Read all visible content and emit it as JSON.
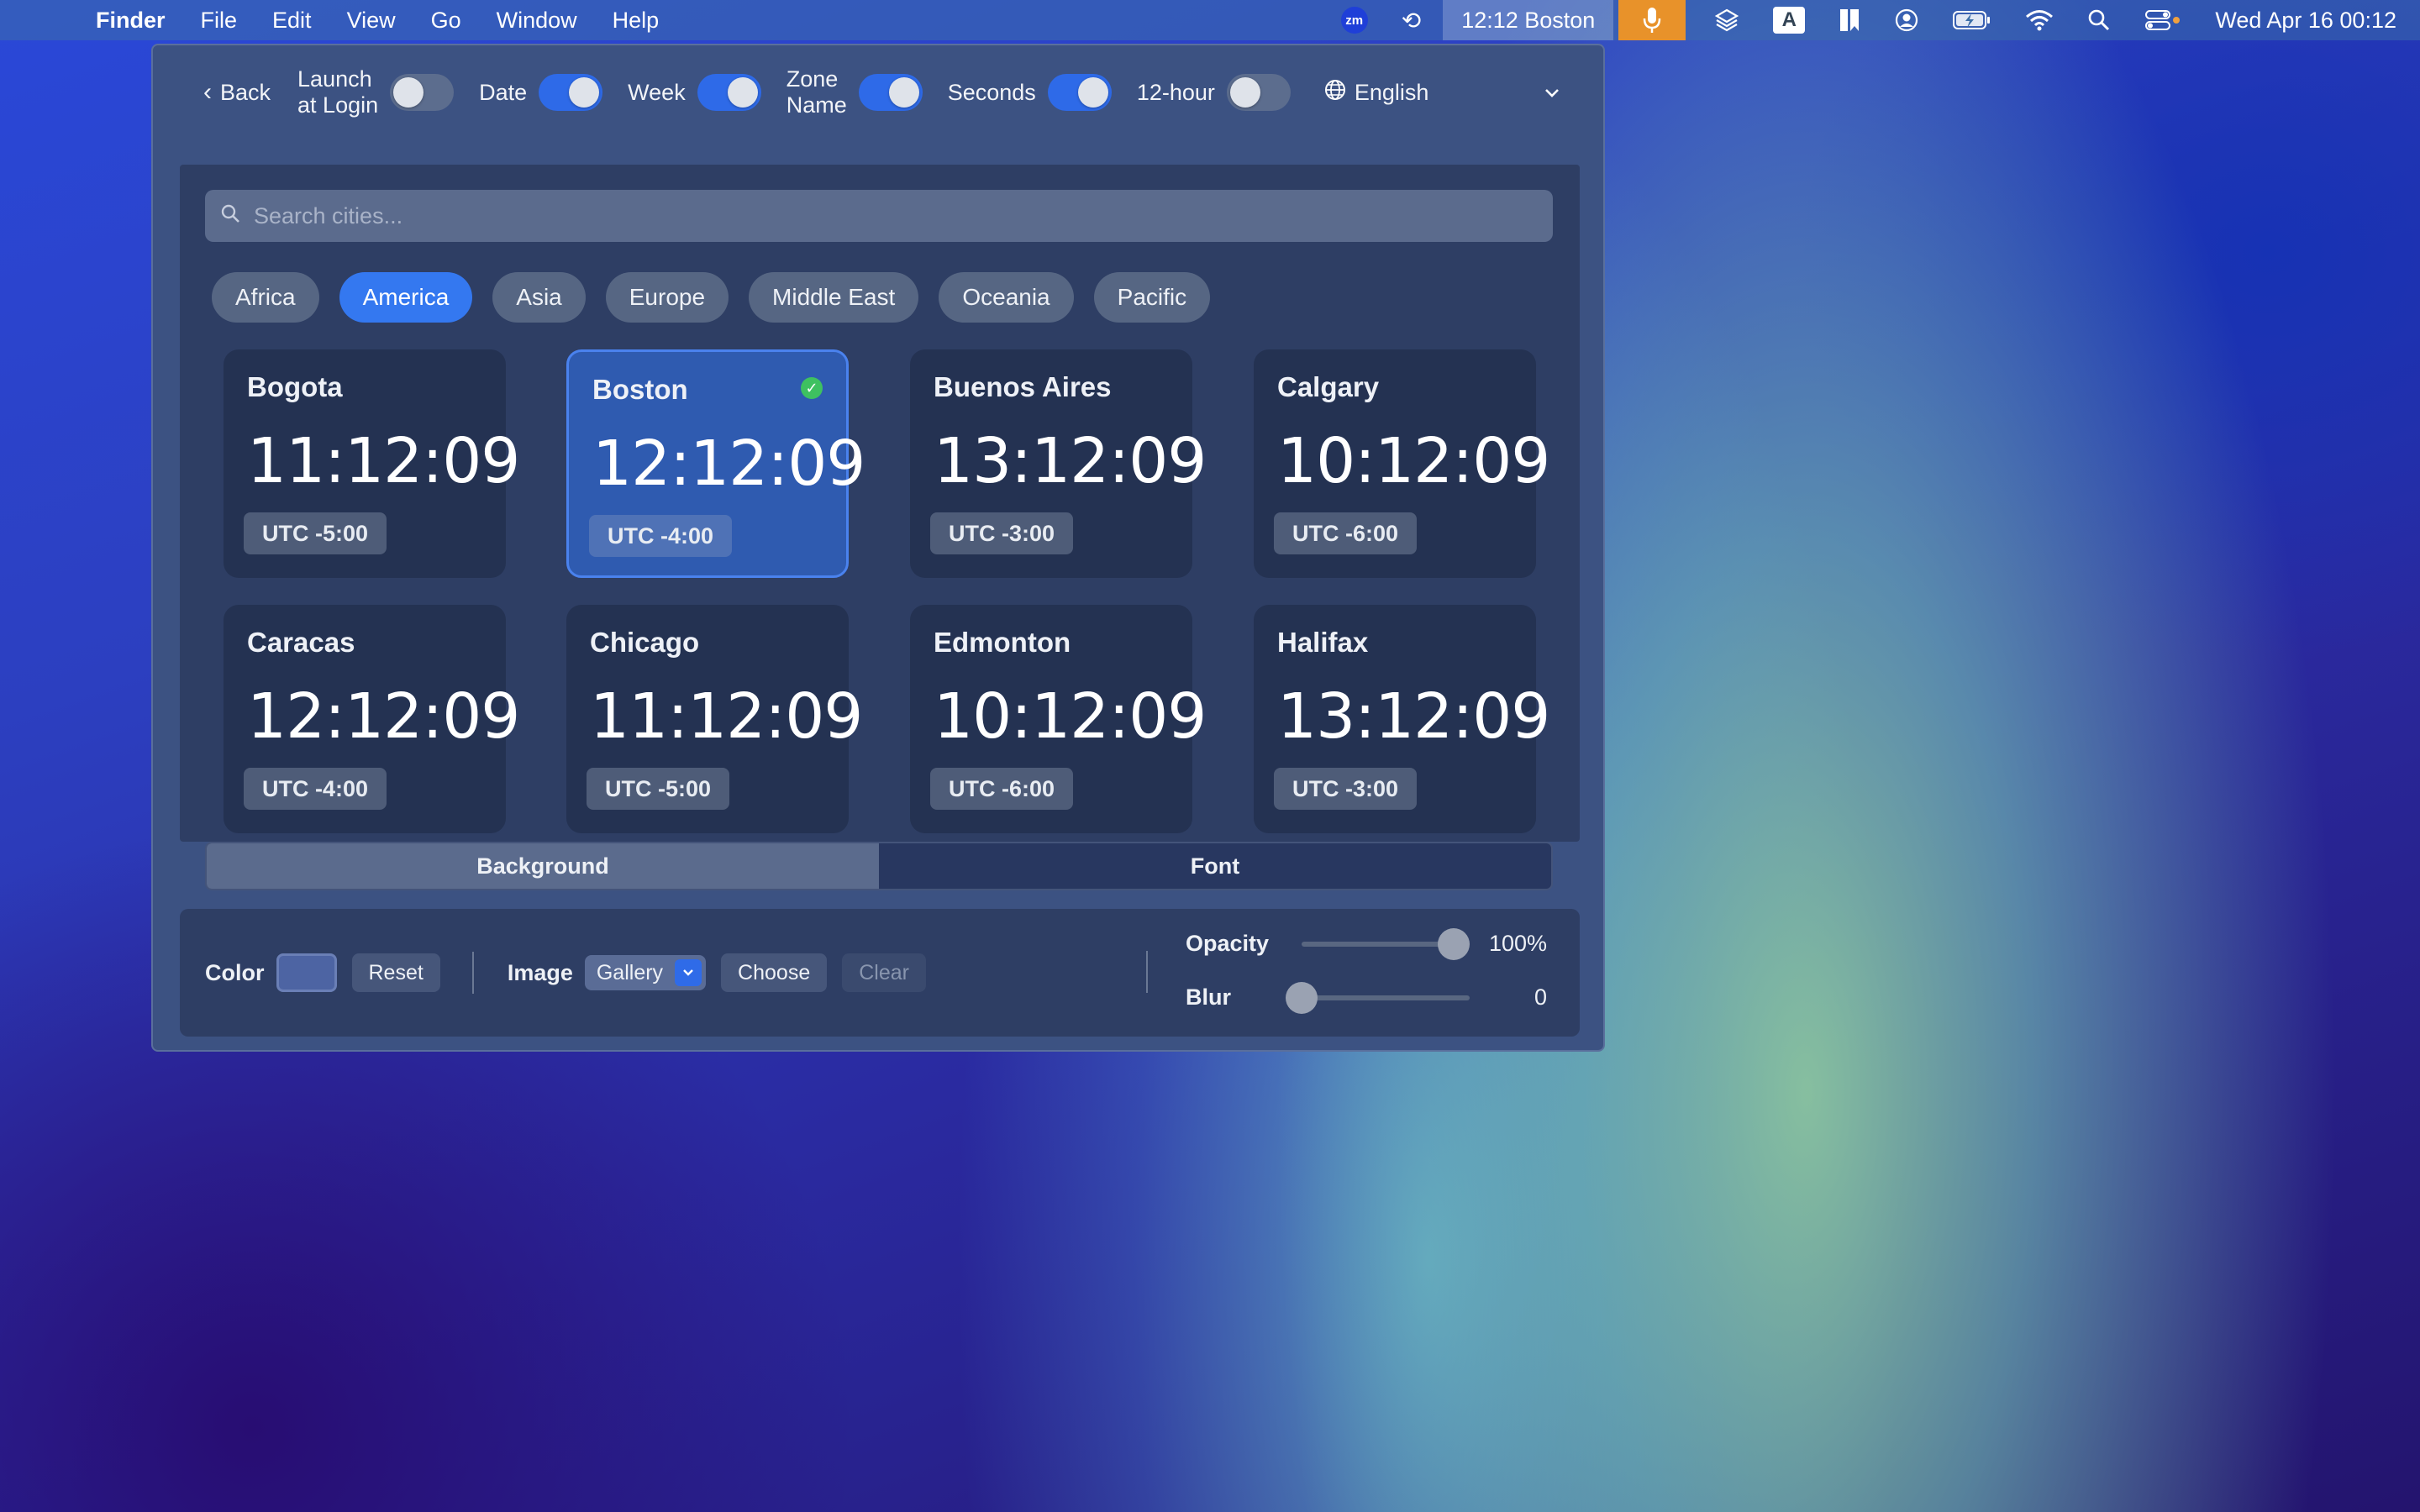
{
  "menubar": {
    "app": "Finder",
    "items": [
      "File",
      "Edit",
      "View",
      "Go",
      "Window",
      "Help"
    ],
    "zoom_badge": "zm",
    "clock_widget": "12:12 Boston",
    "input_badge": "A",
    "datetime": "Wed Apr 16  00:12",
    "icons": [
      "apple-icon",
      "zoom-icon",
      "screen-rotation-icon",
      "microphone-icon",
      "layers-icon",
      "input-source-icon",
      "bookmark-icon",
      "user-icon",
      "battery-icon",
      "wifi-icon",
      "search-icon",
      "control-center-icon"
    ]
  },
  "toolbar": {
    "back": "Back",
    "toggles": [
      {
        "label_line1": "Launch",
        "label_line2": "at Login",
        "on": false
      },
      {
        "label_line1": "Date",
        "label_line2": "",
        "on": true
      },
      {
        "label_line1": "Week",
        "label_line2": "",
        "on": true
      },
      {
        "label_line1": "Zone",
        "label_line2": "Name",
        "on": true
      },
      {
        "label_line1": "Seconds",
        "label_line2": "",
        "on": true
      },
      {
        "label_line1": "12-hour",
        "label_line2": "",
        "on": false
      }
    ],
    "language": "English"
  },
  "search": {
    "placeholder": "Search cities..."
  },
  "regions": [
    {
      "label": "Africa",
      "active": false
    },
    {
      "label": "America",
      "active": true
    },
    {
      "label": "Asia",
      "active": false
    },
    {
      "label": "Europe",
      "active": false
    },
    {
      "label": "Middle East",
      "active": false
    },
    {
      "label": "Oceania",
      "active": false
    },
    {
      "label": "Pacific",
      "active": false
    }
  ],
  "cities": [
    {
      "name": "Bogota",
      "time": "11:12:09",
      "utc": "UTC -5:00",
      "selected": false
    },
    {
      "name": "Boston",
      "time": "12:12:09",
      "utc": "UTC -4:00",
      "selected": true
    },
    {
      "name": "Buenos Aires",
      "time": "13:12:09",
      "utc": "UTC -3:00",
      "selected": false
    },
    {
      "name": "Calgary",
      "time": "10:12:09",
      "utc": "UTC -6:00",
      "selected": false
    },
    {
      "name": "Caracas",
      "time": "12:12:09",
      "utc": "UTC -4:00",
      "selected": false
    },
    {
      "name": "Chicago",
      "time": "11:12:09",
      "utc": "UTC -5:00",
      "selected": false
    },
    {
      "name": "Edmonton",
      "time": "10:12:09",
      "utc": "UTC -6:00",
      "selected": false
    },
    {
      "name": "Halifax",
      "time": "13:12:09",
      "utc": "UTC -3:00",
      "selected": false
    }
  ],
  "tabs": [
    {
      "label": "Background",
      "active": true
    },
    {
      "label": "Font",
      "active": false
    }
  ],
  "background": {
    "color_label": "Color",
    "color_value": "#4d64a3",
    "reset": "Reset",
    "image_label": "Image",
    "image_source": "Gallery",
    "choose": "Choose",
    "clear": "Clear",
    "opacity_label": "Opacity",
    "opacity_value": "100%",
    "opacity_fraction": 1.0,
    "blur_label": "Blur",
    "blur_value": "0",
    "blur_fraction": 0.0
  }
}
